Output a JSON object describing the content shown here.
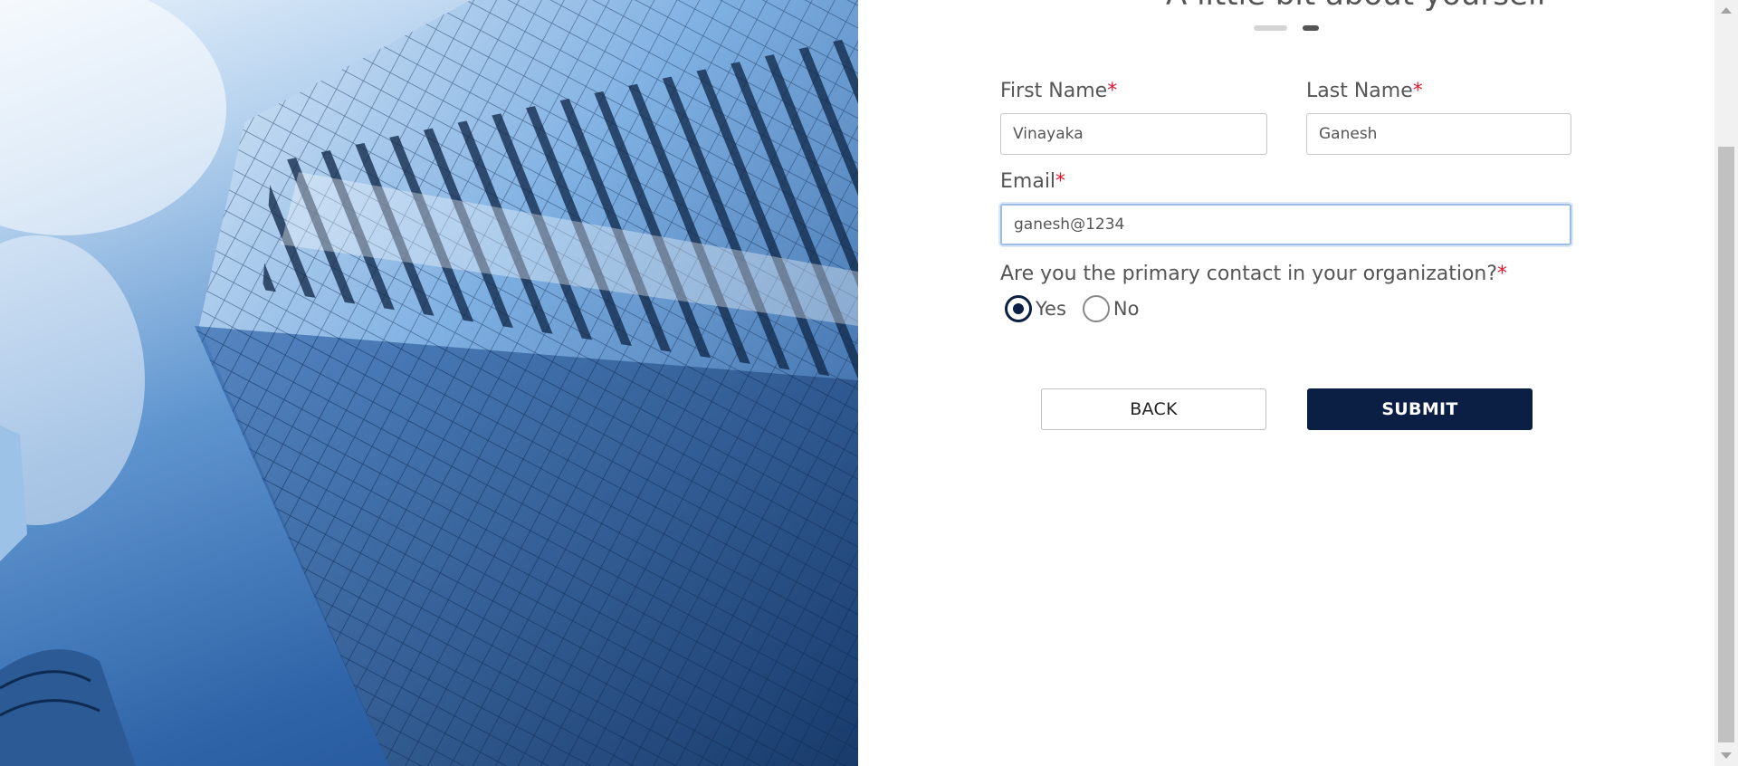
{
  "form": {
    "heading": "A little bit about yourself",
    "first_name": {
      "label": "First Name",
      "required_mark": "*",
      "value": "Vinayaka"
    },
    "last_name": {
      "label": "Last Name",
      "required_mark": "*",
      "value": "Ganesh"
    },
    "email": {
      "label": "Email",
      "required_mark": "*",
      "value": "ganesh@1234"
    },
    "primary_contact": {
      "question": "Are you the primary contact in your organization?",
      "required_mark": "*",
      "options": [
        {
          "label": "Yes",
          "selected": true
        },
        {
          "label": "No",
          "selected": false
        }
      ]
    },
    "back_label": "BACK",
    "submit_label": "SUBMIT"
  },
  "steps": {
    "current": 2,
    "total": 2
  },
  "colors": {
    "primary": "#0b1f44",
    "required": "#e0182d",
    "text": "#555555"
  },
  "icons": {
    "hero": "skyscraper-photo"
  }
}
